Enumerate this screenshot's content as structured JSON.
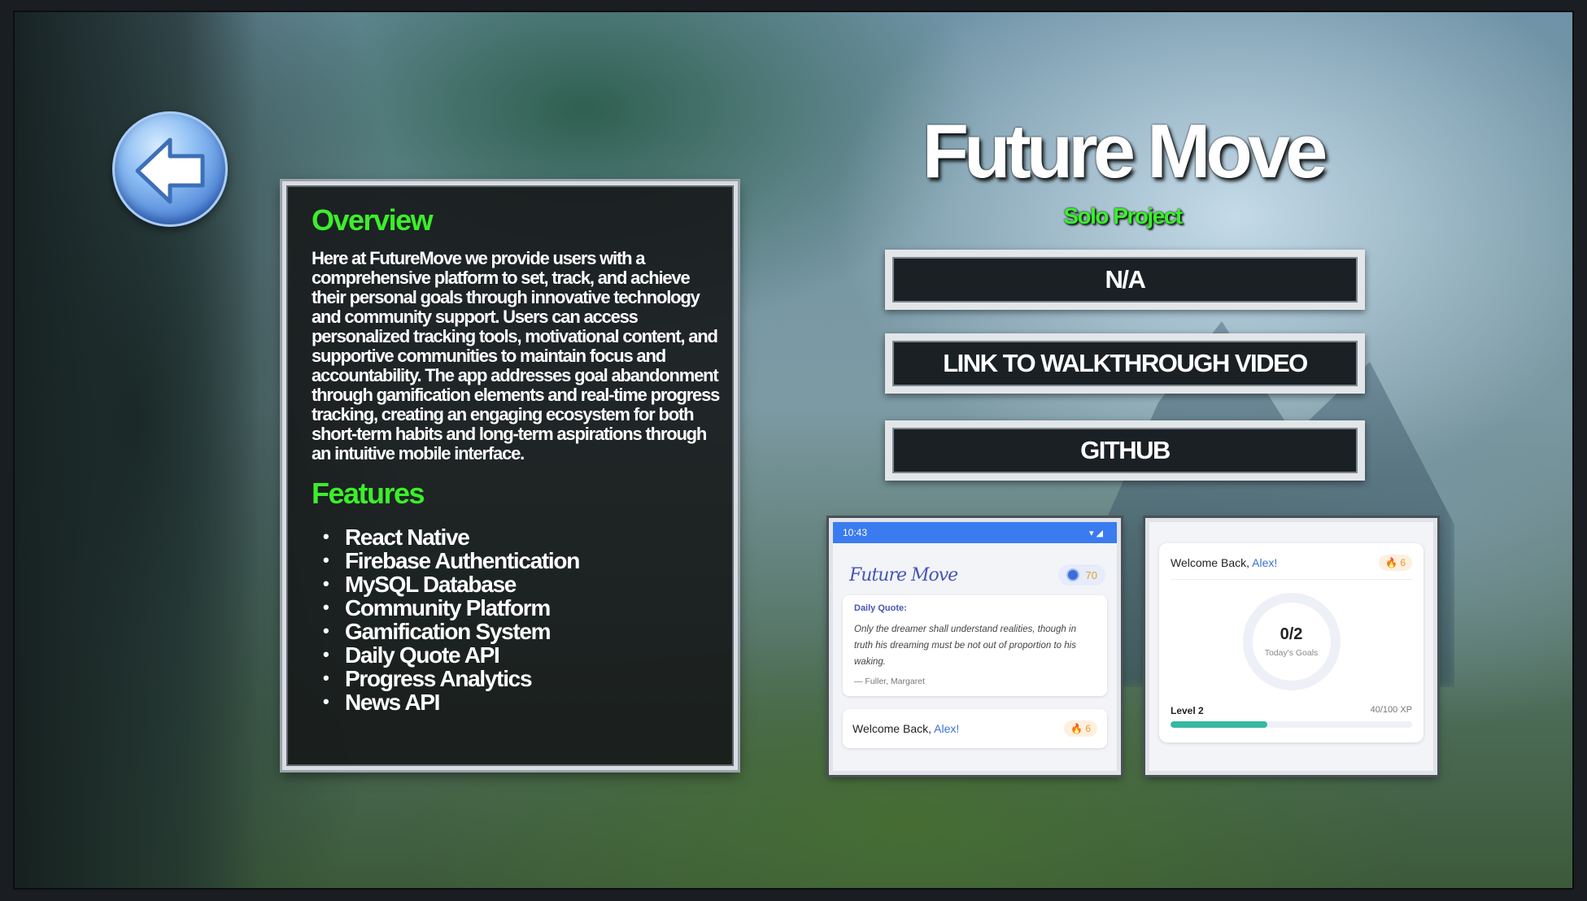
{
  "colors": {
    "accent_green": "#3bef2a",
    "panel_bg": "#16181a",
    "button_bg": "#1b2024",
    "app_blue": "#3a7bf0"
  },
  "back_button": {
    "icon": "left-arrow-icon"
  },
  "info": {
    "overview_heading": "Overview",
    "overview_text": "Here at FutureMove we provide users with a comprehensive platform to set, track, and achieve their personal goals through innovative technology and community support. Users can access personalized tracking tools, motivational content, and supportive communities to maintain focus and accountability. The app addresses goal abandonment through gamification elements and real-time progress tracking, creating an engaging ecosystem for both short-term habits and long-term aspirations through an intuitive mobile interface.",
    "features_heading": "Features",
    "features": [
      "React Native",
      "Firebase Authentication",
      "MySQL Database",
      "Community Platform",
      "Gamification System",
      "Daily Quote API",
      "Progress Analytics",
      "News API"
    ]
  },
  "project": {
    "title": "Future Move",
    "subtitle": "Solo Project",
    "links": [
      {
        "label": "N/A"
      },
      {
        "label": "LINK TO WALKTHROUGH VIDEO"
      },
      {
        "label": "GITHUB"
      }
    ]
  },
  "screenshot_home": {
    "time": "10:43",
    "logo": "Future Move",
    "points": "70",
    "quote_label": "Daily Quote:",
    "quote_text": "Only the dreamer shall understand realities, though in truth his dreaming must be not out of proportion to his waking.",
    "quote_author": "— Fuller, Margaret",
    "welcome_prefix": "Welcome Back, ",
    "welcome_name": "Alex!",
    "streak": "6"
  },
  "screenshot_progress": {
    "welcome_prefix": "Welcome Back, ",
    "welcome_name": "Alex!",
    "streak": "6",
    "goals_value": "0/2",
    "goals_label": "Today's Goals",
    "level": "Level 2",
    "xp_text": "40/100 XP",
    "xp_fraction": 0.4
  }
}
